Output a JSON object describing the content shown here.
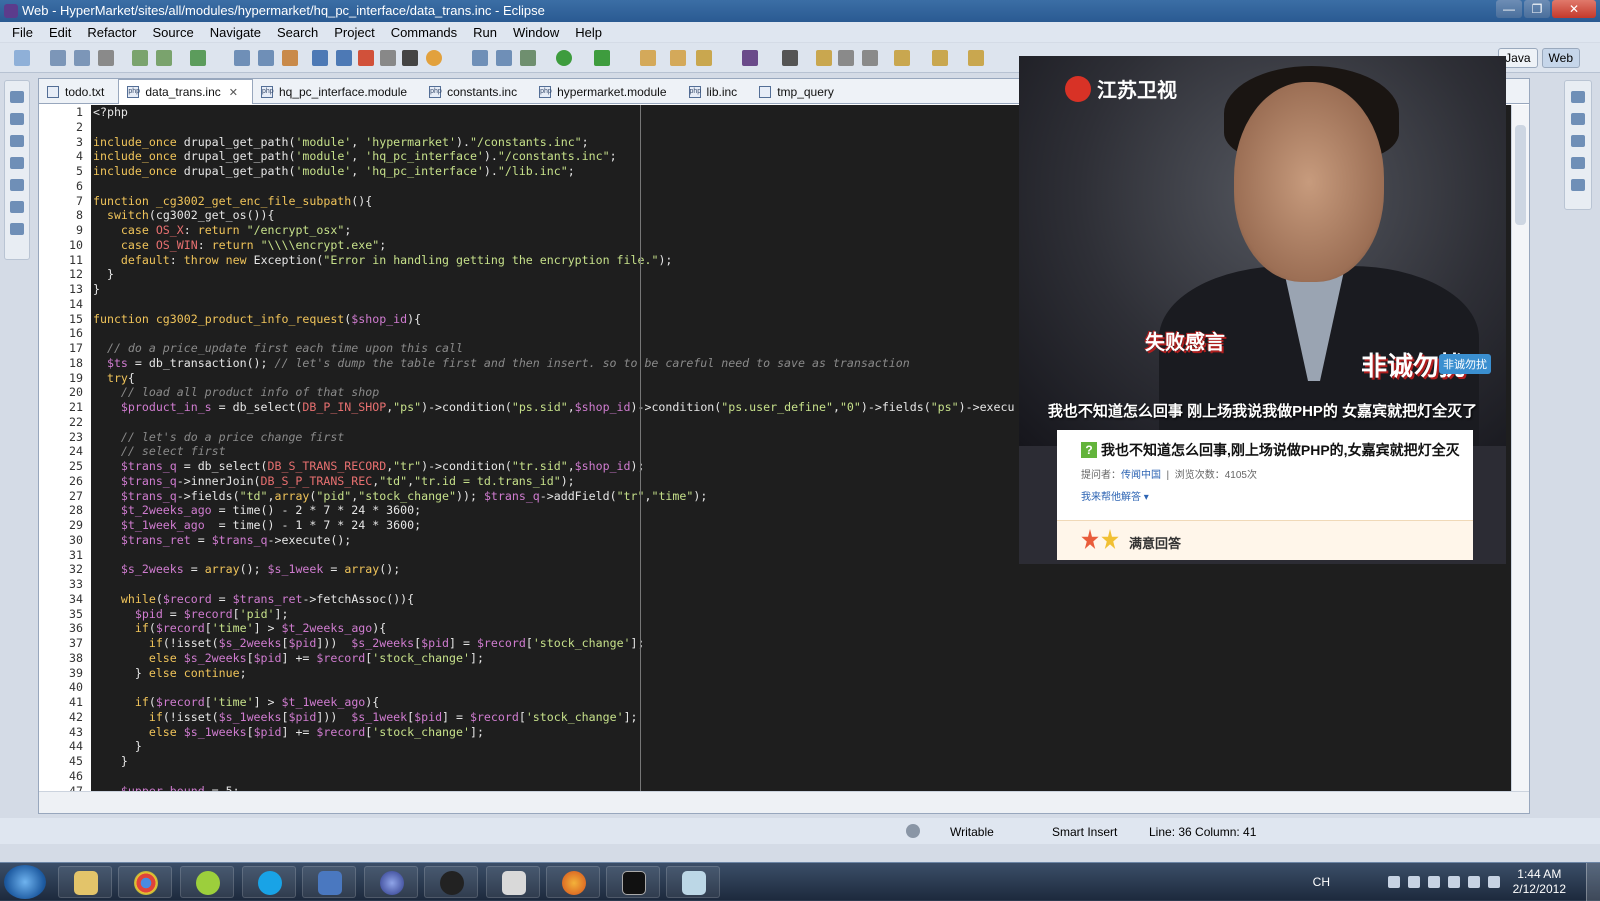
{
  "window": {
    "title": "Web - HyperMarket/sites/all/modules/hypermarket/hq_pc_interface/data_trans.inc - Eclipse",
    "controls": [
      "—",
      "❐",
      "✕"
    ]
  },
  "menu": [
    "File",
    "Edit",
    "Refactor",
    "Source",
    "Navigate",
    "Search",
    "Project",
    "Commands",
    "Run",
    "Window",
    "Help"
  ],
  "perspectives": {
    "java": "Java",
    "web": "Web"
  },
  "tabs": [
    {
      "label": "todo.txt"
    },
    {
      "label": "data_trans.inc",
      "active": true
    },
    {
      "label": "hq_pc_interface.module"
    },
    {
      "label": "constants.inc"
    },
    {
      "label": "hypermarket.module"
    },
    {
      "label": "lib.inc"
    },
    {
      "label": "tmp_query"
    }
  ],
  "code": {
    "line_numbers": [
      "1",
      "2",
      "3",
      "4",
      "5",
      "6",
      "7",
      "8",
      "9",
      "10",
      "11",
      "12",
      "13",
      "14",
      "15",
      "16",
      "17",
      "18",
      "19",
      "20",
      "21",
      "22",
      "23",
      "24",
      "25",
      "26",
      "27",
      "28",
      "29",
      "30",
      "31",
      "32",
      "33",
      "34",
      "35",
      "36",
      "37",
      "38",
      "39",
      "40",
      "41",
      "42",
      "43",
      "44",
      "45",
      "46",
      "47"
    ],
    "lines": [
      "<?php",
      "",
      "include_once drupal_get_path('module', 'hypermarket').\"/constants.inc\";",
      "include_once drupal_get_path('module', 'hq_pc_interface').\"/constants.inc\";",
      "include_once drupal_get_path('module', 'hq_pc_interface').\"/lib.inc\";",
      "",
      "function _cg3002_get_enc_file_subpath(){",
      "  switch(cg3002_get_os()){",
      "    case OS_X: return \"/encrypt_osx\";",
      "    case OS_WIN: return \"\\\\\\\\encrypt.exe\";",
      "    default: throw new Exception(\"Error in handling getting the encryption file.\");",
      "  }",
      "}",
      "",
      "function cg3002_product_info_request($shop_id){",
      "",
      "  // do a price_update first each time upon this call",
      "  $ts = db_transaction(); // let's dump the table first and then insert. so to be careful need to save as transaction",
      "  try{",
      "    // load all product info of that shop",
      "    $product_in_s = db_select(DB_P_IN_SHOP,\"ps\")->condition(\"ps.sid\",$shop_id)->condition(\"ps.user_define\",\"0\")->fields(\"ps\")->execu",
      "",
      "    // let's do a price change first",
      "    // select first",
      "    $trans_q = db_select(DB_S_TRANS_RECORD,\"tr\")->condition(\"tr.sid\",$shop_id);",
      "    $trans_q->innerJoin(DB_S_P_TRANS_REC,\"td\",\"tr.id = td.trans_id\");",
      "    $trans_q->fields(\"td\",array(\"pid\",\"stock_change\")); $trans_q->addField(\"tr\",\"time\");",
      "    $t_2weeks_ago = time() - 2 * 7 * 24 * 3600;",
      "    $t_1week_ago  = time() - 1 * 7 * 24 * 3600;",
      "    $trans_ret = $trans_q->execute();",
      "",
      "    $s_2weeks = array(); $s_1week = array();",
      "",
      "    while($record = $trans_ret->fetchAssoc()){",
      "      $pid = $record['pid'];",
      "      if($record['time'] > $t_2weeks_ago){",
      "        if(!isset($s_2weeks[$pid]))  $s_2weeks[$pid] = $record['stock_change'];",
      "        else $s_2weeks[$pid] += $record['stock_change'];",
      "      } else continue;",
      "",
      "      if($record['time'] > $t_1week_ago){",
      "        if(!isset($s_1weeks[$pid]))  $s_1week[$pid] = $record['stock_change'];",
      "        else $s_1weeks[$pid] += $record['stock_change'];",
      "      }",
      "    }",
      "",
      "    $upper_bound = 5;"
    ]
  },
  "status": {
    "writable": "Writable",
    "insert_mode": "Smart Insert",
    "position": "Line: 36 Column: 41"
  },
  "overlay": {
    "channel_logo": "江苏卫视",
    "caption_red": "失败感言",
    "badge": "非诚勿扰",
    "badge_small": "非诚勿扰",
    "subtitle": "我也不知道怎么回事 刚上场我说我做PHP的 女嘉宾就把灯全灭了",
    "question": "我也不知道怎么回事,刚上场说做PHP的,女嘉宾就把灯全灭",
    "asker_label": "提问者：",
    "asker": "传闻中国",
    "views": "浏览次数：4105次",
    "help": "我来帮他解答 ▾",
    "answer_label": "满意回答"
  },
  "taskbar": {
    "lang": "CH",
    "time": "1:44 AM",
    "date": "2/12/2012"
  },
  "colors": {
    "keyword": "#f0c45a",
    "string": "#c6e08a",
    "variable": "#d07cd0",
    "comment": "#8a8a8a",
    "editor_bg": "#1e1e1e"
  }
}
